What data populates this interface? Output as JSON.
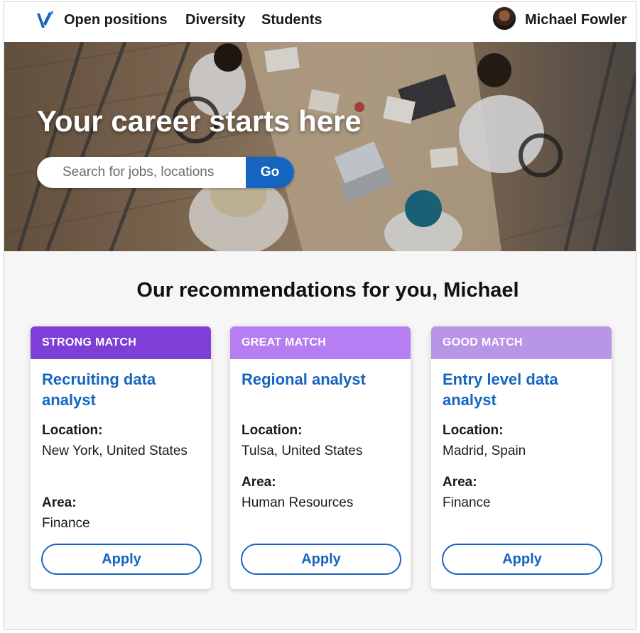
{
  "nav": {
    "links": [
      "Open positions",
      "Diversity",
      "Students"
    ],
    "user_name": "Michael Fowler",
    "logo_icon": "v-logo-icon",
    "avatar_icon": "user-avatar"
  },
  "hero": {
    "title": "Your career starts here",
    "search_placeholder": "Search for jobs, locations",
    "search_button": "Go"
  },
  "recommendations": {
    "title": "Our recommendations for you, Michael",
    "cards": [
      {
        "badge": "STRONG MATCH",
        "badge_color": "#7e3fd6",
        "title": "Recruiting data analyst",
        "location_label": "Location:",
        "location": "New York, United States",
        "area_label": "Area:",
        "area": "Finance",
        "apply": "Apply"
      },
      {
        "badge": "GREAT MATCH",
        "badge_color": "#b57ef2",
        "title": "Regional analyst",
        "location_label": "Location:",
        "location": "Tulsa, United States",
        "area_label": "Area:",
        "area": "Human Resources",
        "apply": "Apply"
      },
      {
        "badge": "GOOD MATCH",
        "badge_color": "#b995e6",
        "title": "Entry level data analyst",
        "location_label": "Location:",
        "location": "Madrid, Spain",
        "area_label": "Area:",
        "area": "Finance",
        "apply": "Apply"
      }
    ]
  },
  "colors": {
    "accent": "#1565c0",
    "background": "#f6f6f6"
  }
}
